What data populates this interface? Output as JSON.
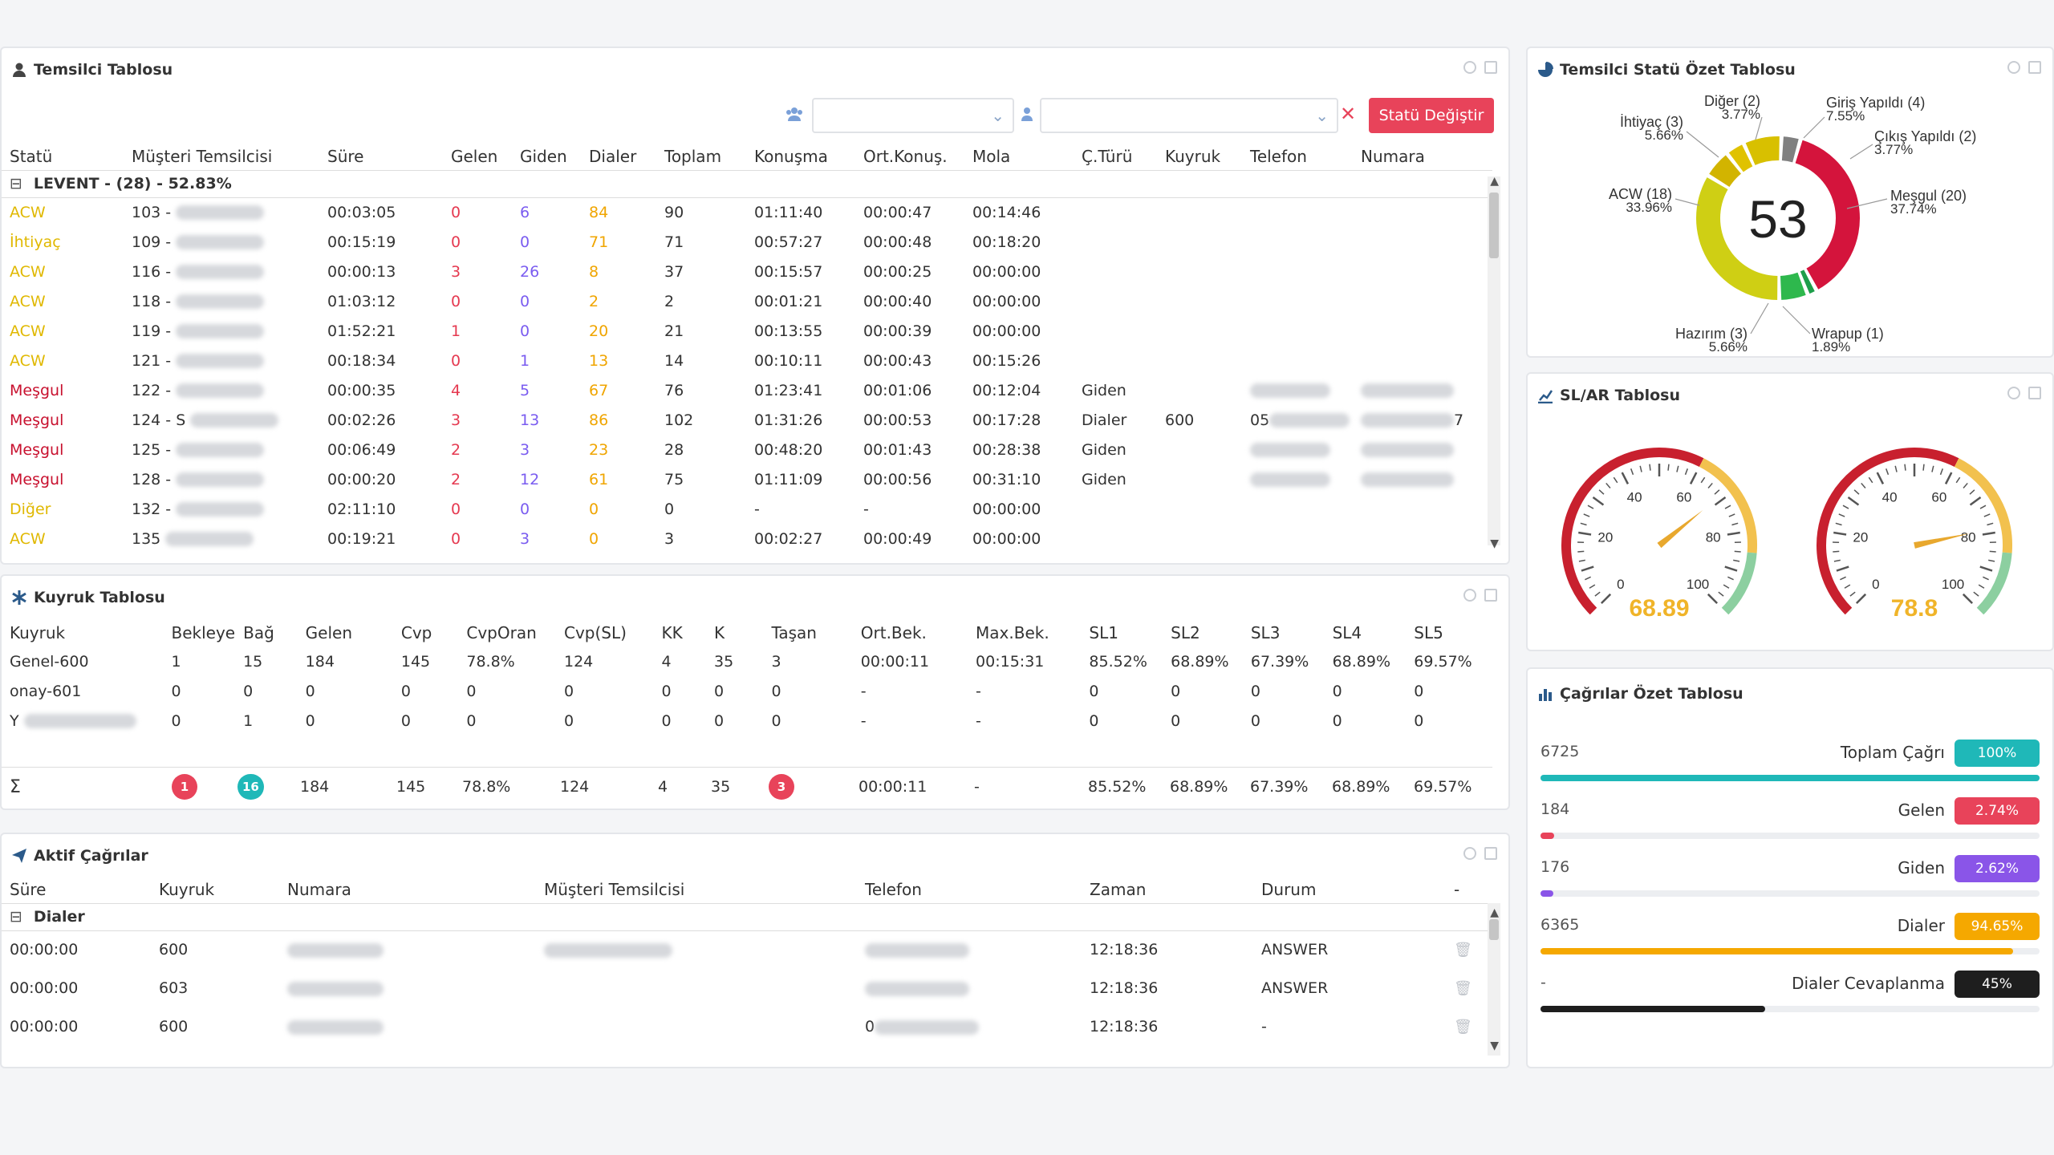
{
  "colors": {
    "acw": "#e0b800",
    "mesgul": "#c8102e",
    "accent_red": "#e8435a",
    "teal": "#1fb8b8",
    "purple": "#7a5cf0",
    "orange": "#f0a500",
    "black": "#222"
  },
  "temsilci": {
    "title": "Temsilci Tablosu",
    "status_button": "Statü Değiştir",
    "columns": [
      "Statü",
      "Müşteri Temsilcisi",
      "Süre",
      "Gelen",
      "Giden",
      "Dialer",
      "Toplam",
      "Konuşma",
      "Ort.Konuş.",
      "Mola",
      "Ç.Türü",
      "Kuyruk",
      "Telefon",
      "Numara"
    ],
    "group_label": "LEVENT - (28) - 52.83%",
    "rows": [
      {
        "status": "ACW",
        "cls": "c-acw",
        "agent": "103 -",
        "sure": "00:03:05",
        "gelen": "0",
        "giden": "6",
        "dialer": "84",
        "toplam": "90",
        "konusma": "01:11:40",
        "ort": "00:00:47",
        "mola": "00:14:46",
        "tur": "",
        "kuyruk": "",
        "telefon": "",
        "numara": "",
        "tb": 0,
        "nb": 0
      },
      {
        "status": "İhtiyaç",
        "cls": "c-iht",
        "agent": "109 -",
        "sure": "00:15:19",
        "gelen": "0",
        "giden": "0",
        "dialer": "71",
        "toplam": "71",
        "konusma": "00:57:27",
        "ort": "00:00:48",
        "mola": "00:18:20",
        "tur": "",
        "kuyruk": "",
        "telefon": "",
        "numara": "",
        "tb": 0,
        "nb": 0
      },
      {
        "status": "ACW",
        "cls": "c-acw",
        "agent": "116 -",
        "sure": "00:00:13",
        "gelen": "3",
        "giden": "26",
        "dialer": "8",
        "toplam": "37",
        "konusma": "00:15:57",
        "ort": "00:00:25",
        "mola": "00:00:00",
        "tur": "",
        "kuyruk": "",
        "telefon": "",
        "numara": "",
        "tb": 0,
        "nb": 0
      },
      {
        "status": "ACW",
        "cls": "c-acw",
        "agent": "118 -",
        "sure": "01:03:12",
        "gelen": "0",
        "giden": "0",
        "dialer": "2",
        "toplam": "2",
        "konusma": "00:01:21",
        "ort": "00:00:40",
        "mola": "00:00:00",
        "tur": "",
        "kuyruk": "",
        "telefon": "",
        "numara": "",
        "tb": 0,
        "nb": 0
      },
      {
        "status": "ACW",
        "cls": "c-acw",
        "agent": "119 -",
        "sure": "01:52:21",
        "gelen": "1",
        "giden": "0",
        "dialer": "20",
        "toplam": "21",
        "konusma": "00:13:55",
        "ort": "00:00:39",
        "mola": "00:00:00",
        "tur": "",
        "kuyruk": "",
        "telefon": "",
        "numara": "",
        "tb": 0,
        "nb": 0
      },
      {
        "status": "ACW",
        "cls": "c-acw",
        "agent": "121 -",
        "sure": "00:18:34",
        "gelen": "0",
        "giden": "1",
        "dialer": "13",
        "toplam": "14",
        "konusma": "00:10:11",
        "ort": "00:00:43",
        "mola": "00:15:26",
        "tur": "",
        "kuyruk": "",
        "telefon": "",
        "numara": "",
        "tb": 0,
        "nb": 0
      },
      {
        "status": "Meşgul",
        "cls": "c-mes",
        "agent": "122 -",
        "sure": "00:00:35",
        "gelen": "4",
        "giden": "5",
        "dialer": "67",
        "toplam": "76",
        "konusma": "01:23:41",
        "ort": "00:01:06",
        "mola": "00:12:04",
        "tur": "Giden",
        "kuyruk": "",
        "telefon": "",
        "numara": "",
        "tb": 1,
        "nb": 1
      },
      {
        "status": "Meşgul",
        "cls": "c-mes",
        "agent": "124 - S",
        "sure": "00:02:26",
        "gelen": "3",
        "giden": "13",
        "dialer": "86",
        "toplam": "102",
        "konusma": "01:31:26",
        "ort": "00:00:53",
        "mola": "00:17:28",
        "tur": "Dialer",
        "kuyruk": "600",
        "telefon": "05",
        "numara": "7",
        "tb": 1,
        "nb": 1
      },
      {
        "status": "Meşgul",
        "cls": "c-mes",
        "agent": "125 -",
        "sure": "00:06:49",
        "gelen": "2",
        "giden": "3",
        "dialer": "23",
        "toplam": "28",
        "konusma": "00:48:20",
        "ort": "00:01:43",
        "mola": "00:28:38",
        "tur": "Giden",
        "kuyruk": "",
        "telefon": "",
        "numara": "",
        "tb": 1,
        "nb": 1
      },
      {
        "status": "Meşgul",
        "cls": "c-mes",
        "agent": "128 -",
        "sure": "00:00:20",
        "gelen": "2",
        "giden": "12",
        "dialer": "61",
        "toplam": "75",
        "konusma": "01:11:09",
        "ort": "00:00:56",
        "mola": "00:31:10",
        "tur": "Giden",
        "kuyruk": "",
        "telefon": "",
        "numara": "",
        "tb": 1,
        "nb": 1
      },
      {
        "status": "Diğer",
        "cls": "c-dig",
        "agent": "132 -",
        "sure": "02:11:10",
        "gelen": "0",
        "giden": "0",
        "dialer": "0",
        "toplam": "0",
        "konusma": "-",
        "ort": "-",
        "mola": "00:00:00",
        "tur": "",
        "kuyruk": "",
        "telefon": "",
        "numara": "",
        "tb": 0,
        "nb": 0
      },
      {
        "status": "ACW",
        "cls": "c-acw",
        "agent": "135",
        "sure": "00:19:21",
        "gelen": "0",
        "giden": "3",
        "dialer": "0",
        "toplam": "3",
        "konusma": "00:02:27",
        "ort": "00:00:49",
        "mola": "00:00:00",
        "tur": "",
        "kuyruk": "",
        "telefon": "",
        "numara": "",
        "tb": 0,
        "nb": 0
      }
    ]
  },
  "kuyruk": {
    "title": "Kuyruk Tablosu",
    "columns": [
      "Kuyruk",
      "Bekleye",
      "Bağ",
      "Gelen",
      "Cvp",
      "CvpOran",
      "Cvp(SL)",
      "KK",
      "K",
      "Taşan",
      "Ort.Bek.",
      "Max.Bek.",
      "SL1",
      "SL2",
      "SL3",
      "SL4",
      "SL5"
    ],
    "rows": [
      [
        "Genel-600",
        "1",
        "15",
        "184",
        "145",
        "78.8%",
        "124",
        "4",
        "35",
        "3",
        "00:00:11",
        "00:15:31",
        "85.52%",
        "68.89%",
        "67.39%",
        "68.89%",
        "69.57%"
      ],
      [
        "onay-601",
        "0",
        "0",
        "0",
        "0",
        "0",
        "0",
        "0",
        "0",
        "0",
        "-",
        "-",
        "0",
        "0",
        "0",
        "0",
        "0"
      ],
      [
        "Y",
        "0",
        "1",
        "0",
        "0",
        "0",
        "0",
        "0",
        "0",
        "0",
        "-",
        "-",
        "0",
        "0",
        "0",
        "0",
        "0"
      ]
    ],
    "sum": {
      "label": "Σ",
      "bekleye": "1",
      "bag": "16",
      "gelen": "184",
      "cvp": "145",
      "cvporan": "78.8%",
      "cvpsl": "124",
      "kk": "4",
      "k": "35",
      "tasan": "3",
      "ortbek": "00:00:11",
      "maxbek": "-",
      "sl1": "85.52%",
      "sl2": "68.89%",
      "sl3": "67.39%",
      "sl4": "68.89%",
      "sl5": "69.57%"
    }
  },
  "aktif": {
    "title": "Aktif Çağrılar",
    "columns": [
      "Süre",
      "Kuyruk",
      "Numara",
      "Müşteri Temsilcisi",
      "Telefon",
      "Zaman",
      "Durum",
      "-"
    ],
    "group_label": "Dialer",
    "rows": [
      {
        "sure": "00:00:00",
        "kuyruk": "600",
        "zaman": "12:18:36",
        "durum": "ANSWER",
        "tel_prefix": ""
      },
      {
        "sure": "00:00:00",
        "kuyruk": "603",
        "zaman": "12:18:36",
        "durum": "ANSWER",
        "tel_prefix": ""
      },
      {
        "sure": "00:00:00",
        "kuyruk": "600",
        "zaman": "12:18:36",
        "durum": "-",
        "tel_prefix": "0"
      }
    ]
  },
  "statu": {
    "title": "Temsilci Statü Özet Tablosu",
    "total": "53",
    "slices": [
      {
        "name": "Meşgul (20)",
        "pct": "37.74%",
        "value": 20,
        "color": "#d4143c"
      },
      {
        "name": "Wrapup (1)",
        "pct": "1.89%",
        "value": 1,
        "color": "#1e9e4a"
      },
      {
        "name": "Hazırım (3)",
        "pct": "5.66%",
        "value": 3,
        "color": "#2eb84d"
      },
      {
        "name": "ACW (18)",
        "pct": "33.96%",
        "value": 18,
        "color": "#cfcf14"
      },
      {
        "name": "İhtiyaç (3)",
        "pct": "5.66%",
        "value": 3,
        "color": "#d2b400"
      },
      {
        "name": "Diğer (2)",
        "pct": "3.77%",
        "value": 2,
        "color": "#e0c200"
      },
      {
        "name": "Giriş Yapıldı (4)",
        "pct": "7.55%",
        "value": 4,
        "color": "#d8c000"
      },
      {
        "name": "Çıkış Yapıldı (2)",
        "pct": "3.77%",
        "value": 2,
        "color": "#808080"
      }
    ]
  },
  "slar": {
    "title": "SL/AR Tablosu",
    "gauges": [
      {
        "value": 68.89,
        "label": "68.89",
        "ticks": [
          "0",
          "20",
          "40",
          "60",
          "80",
          "100"
        ]
      },
      {
        "value": 78.8,
        "label": "78.8",
        "ticks": [
          "0",
          "20",
          "40",
          "60",
          "80",
          "100"
        ]
      }
    ]
  },
  "cagri": {
    "title": "Çağrılar Özet Tablosu",
    "rows": [
      {
        "num": "6725",
        "label": "Toplam Çağrı",
        "badge": "100%",
        "pct": 100,
        "color": "#1fb8b8"
      },
      {
        "num": "184",
        "label": "Gelen",
        "badge": "2.74%",
        "pct": 2.74,
        "color": "#e8435a"
      },
      {
        "num": "176",
        "label": "Giden",
        "badge": "2.62%",
        "pct": 2.62,
        "color": "#8a55e8"
      },
      {
        "num": "6365",
        "label": "Dialer",
        "badge": "94.65%",
        "pct": 94.65,
        "color": "#f5a800"
      },
      {
        "num": "-",
        "label": "Dialer Cevaplanma",
        "badge": "45%",
        "pct": 45,
        "color": "#1e1e1e"
      }
    ]
  }
}
